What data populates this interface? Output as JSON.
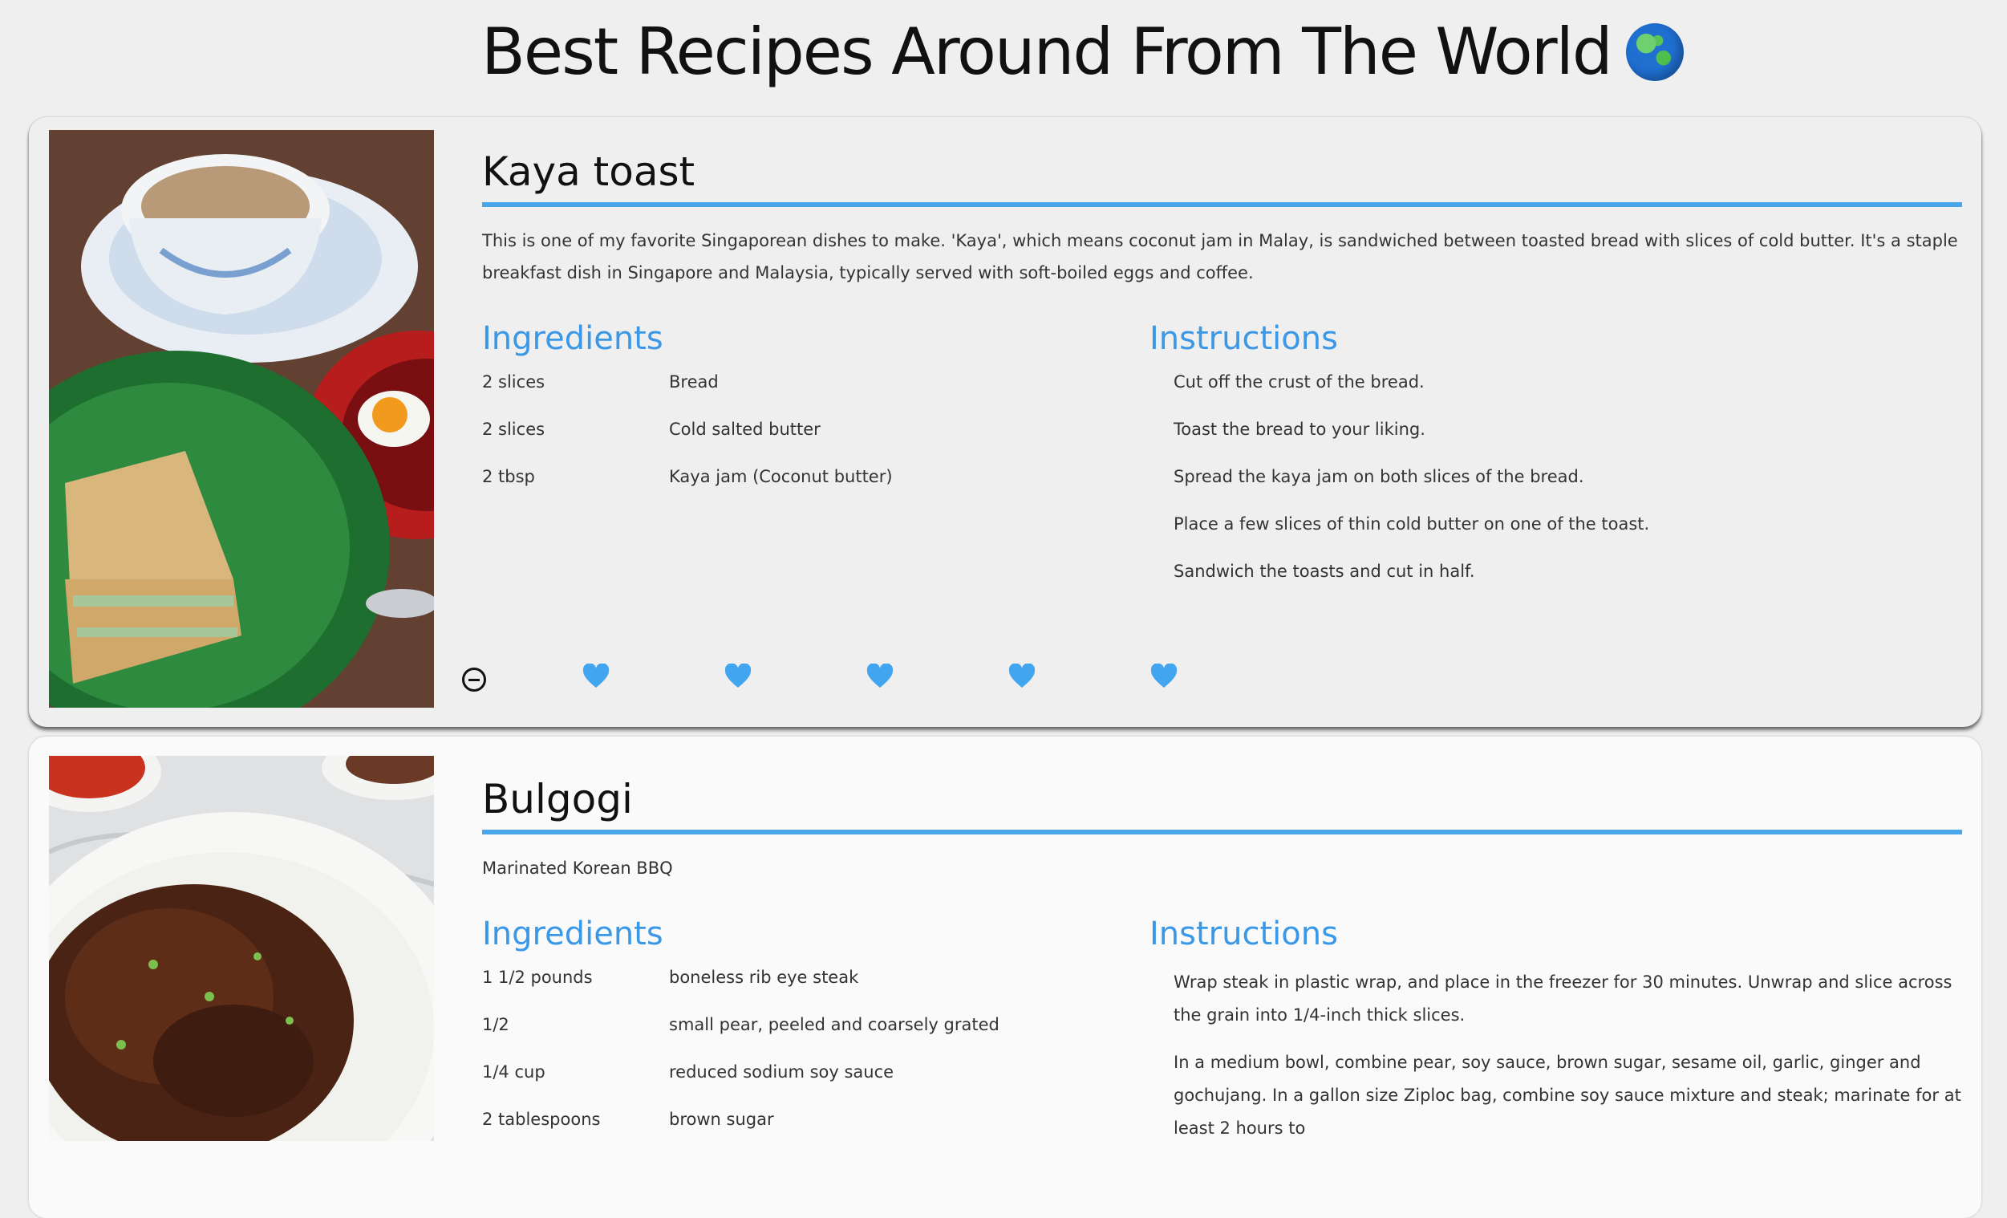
{
  "header": {
    "title": "Best Recipes Around From The World",
    "globe_icon": "globe-icon"
  },
  "colors": {
    "accent": "#4aa6ea",
    "heading_blue": "#3b98e6",
    "heart": "#42a5f0"
  },
  "recipes": [
    {
      "title": "Kaya toast",
      "description": "This is one of my favorite Singaporean dishes to make. 'Kaya', which means coconut jam in Malay, is sandwiched between toasted bread with slices of cold butter. It's a staple breakfast dish in Singapore and Malaysia, typically served with soft-boiled eggs and coffee.",
      "ingredients_heading": "Ingredients",
      "instructions_heading": "Instructions",
      "ingredients": [
        {
          "qty": "2 slices",
          "item": "Bread"
        },
        {
          "qty": "2 slices",
          "item": "Cold salted butter"
        },
        {
          "qty": "2 tbsp",
          "item": "Kaya jam (Coconut butter)"
        }
      ],
      "instructions": [
        "Cut off the crust of the bread.",
        "Toast the bread to your liking.",
        "Spread the kaya jam on both slices of the bread.",
        "Place a few slices of thin cold butter on one of the toast.",
        "Sandwich the toasts and cut in half."
      ],
      "rating": {
        "hearts": 5,
        "minus_icon": "minus-circle-icon",
        "heart_icon": "heart-icon"
      }
    },
    {
      "title": "Bulgogi",
      "description": "Marinated Korean BBQ",
      "ingredients_heading": "Ingredients",
      "instructions_heading": "Instructions",
      "ingredients": [
        {
          "qty": "1 1/2 pounds",
          "item": "boneless rib eye steak"
        },
        {
          "qty": "1/2",
          "item": "small pear, peeled and coarsely grated"
        },
        {
          "qty": "1/4 cup",
          "item": "reduced sodium soy sauce"
        },
        {
          "qty": "2 tablespoons",
          "item": "brown sugar"
        }
      ],
      "instructions": [
        "Wrap steak in plastic wrap, and place in the freezer for 30 minutes. Unwrap and slice across the grain into 1/4-inch thick slices.",
        "In a medium bowl, combine pear, soy sauce, brown sugar, sesame oil, garlic, ginger and gochujang. In a gallon size Ziploc bag, combine soy sauce mixture and steak; marinate for at least 2 hours to"
      ]
    }
  ]
}
